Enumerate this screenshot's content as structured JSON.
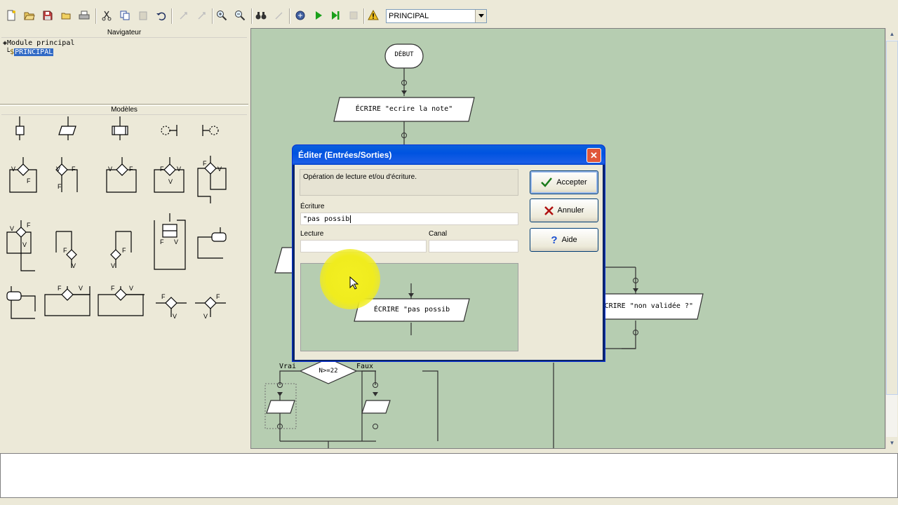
{
  "toolbar": {
    "program_combo": "PRINCIPAL"
  },
  "navigator": {
    "title": "Navigateur",
    "tree": {
      "root": "Module principal",
      "child": "PRINCIPAL"
    }
  },
  "models": {
    "title": "Modèles"
  },
  "flowchart": {
    "start": "DÉBUT",
    "write_note": "ÉCRIRE \"ecrire la note\"",
    "write_invalid": "ÉCRIRE \"non validée ?\"",
    "condition": "N>=22",
    "true_label": "Vrai",
    "false_label": "Faux"
  },
  "dialog": {
    "title": "Éditer (Entrées/Sorties)",
    "description": "Opération de lecture et/ou d'écriture.",
    "ecriture_label": "Écriture",
    "ecriture_value": "\"pas possib",
    "lecture_label": "Lecture",
    "lecture_value": "",
    "canal_label": "Canal",
    "canal_value": "",
    "preview_text": "ÉCRIRE \"pas possib",
    "accept_label": "Accepter",
    "cancel_label": "Annuler",
    "help_label": "Aide"
  },
  "colors": {
    "canvas_bg": "#b6cdb1",
    "window_bg": "#ece9d8",
    "titlebar": "#0053e0",
    "selection": "#316ac5",
    "cursor_highlight": "#f0ec1e"
  },
  "icons": [
    "new-icon",
    "open-icon",
    "save-icon",
    "folder-icon",
    "print-icon",
    "cut-icon",
    "copy-icon",
    "paste-icon",
    "undo-icon",
    "redo-icon",
    "redo2-icon",
    "zoom-in-icon",
    "zoom-out-icon",
    "find-icon",
    "replace-icon",
    "compile-icon",
    "run-icon",
    "step-icon",
    "stop-icon",
    "warning-icon"
  ]
}
